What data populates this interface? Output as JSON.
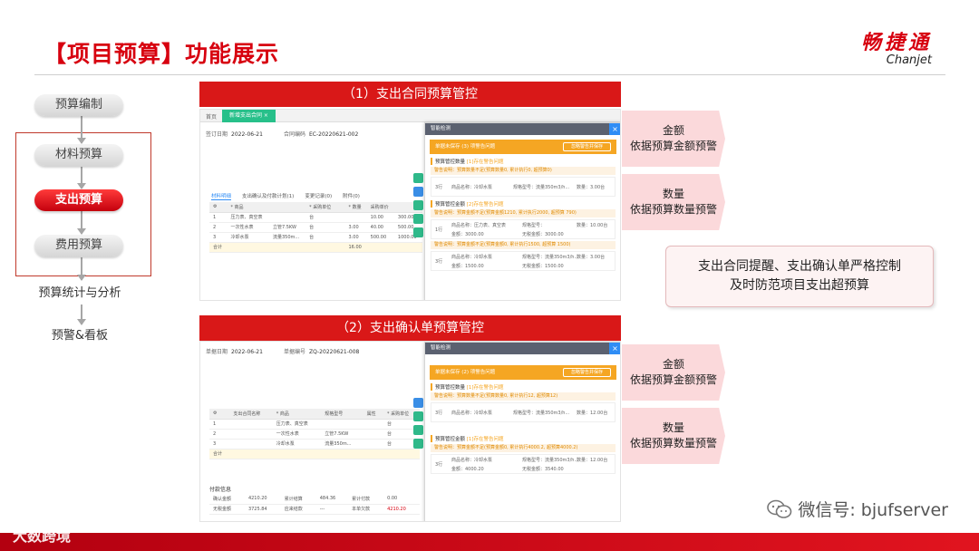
{
  "header": {
    "title": "【项目预算】功能展示",
    "logo_cn": "畅捷通",
    "logo_en": "Chanjet"
  },
  "flow": {
    "step1": "预算编制",
    "step2": "材料预算",
    "step3": "支出预算",
    "step4": "费用预算",
    "step5": "预算统计与分析",
    "step6": "预警&看板"
  },
  "panel1": {
    "banner": "（1）支出合同预算管控",
    "tab_home": "首页",
    "tab_active": "新增支出合同 ×",
    "date_label": "签订日期",
    "date_value": "2022-06-21",
    "code_label": "合同编码",
    "code_value": "EC-20220621-002",
    "subtabs": [
      "材料明细",
      "支出确认及付款计划(1)",
      "变更记录(0)",
      "附件(0)"
    ],
    "columns": [
      "⚙",
      "* 商品",
      "",
      "* 采购单位",
      "",
      "* 数量",
      "采购单价",
      ""
    ],
    "rows": [
      [
        "1",
        "压力表、真空表",
        "",
        "台",
        "",
        "",
        "10.00",
        "300.00"
      ],
      [
        "2",
        "一次性水表",
        "立管7.5KW",
        "台",
        "",
        "3.00",
        "40.00",
        "500.00"
      ],
      [
        "3",
        "冷却水泵",
        "流量350m...",
        "台",
        "",
        "3.00",
        "500.00",
        "1000.00"
      ]
    ],
    "total_label": "合计",
    "total_value": "16.00",
    "dialog": {
      "title": "智能检测",
      "alert": "单据未保存 (3) 项警告问题",
      "alert_button": "忽略警告并保存",
      "sec1": "预算管控数量",
      "sec1_tag": "[1]存在警告问题",
      "warn1": "警告说明：预算数量不足(预算数量0, 累计执行0, 超预算0)",
      "item1": {
        "idx": "3行",
        "name": "商品名称：冷却水泵",
        "spec": "规格型号：流量350m3/h...",
        "qty": "数量：3.00台"
      },
      "sec2": "预算管控金额",
      "sec2_tag": "[2]存在警告问题",
      "warn2": "警告说明：预算金额不足(预算金额1210, 累计执行2000, 超预算 790)",
      "item2": {
        "idx": "1行",
        "name": "商品名称：压力表、真空表",
        "spec": "规格型号：",
        "qty": "数量：10.00台",
        "amount": "金额：3000.00",
        "tax": "无税金额：3000.00"
      },
      "warn3": "警告说明：预算金额不足(预算金额0, 累计执行1500, 超预算 1500)",
      "item3": {
        "idx": "3行",
        "name": "商品名称：冷却水泵",
        "spec": "规格型号：流量350m3/h...",
        "qty": "数量：3.00台",
        "amount": "金额：1500.00",
        "tax": "无税金额：1500.00"
      }
    }
  },
  "panel2": {
    "banner": "（2）支出确认单预算管控",
    "date_label": "单据日期",
    "date_value": "2022-06-21",
    "code_label": "单据编号",
    "code_value": "ZQ-20220621-008",
    "columns": [
      "⚙",
      "支出合同名称",
      "* 商品",
      "规格型号",
      "属性",
      "* 采购单位"
    ],
    "rows": [
      [
        "1",
        "",
        "压力表、真空表",
        "",
        "",
        "台"
      ],
      [
        "2",
        "",
        "一次性水表",
        "立管7.5KW",
        "",
        "台"
      ],
      [
        "3",
        "",
        "冷却水泵",
        "流量350m...",
        "",
        "台"
      ]
    ],
    "total_label": "合计",
    "pay_title": "付款信息",
    "pay_rows": [
      [
        "确认金额",
        "4210.20",
        "累计结算",
        "484.36",
        "累计付款",
        "0.00"
      ],
      [
        "无税金额",
        "3725.84",
        "应来结款",
        "---",
        "本单欠款",
        "4210.20"
      ]
    ],
    "dialog": {
      "title": "智能检测",
      "alert": "单据未保存 (2) 项警告问题",
      "alert_button": "忽略警告并保存",
      "sec1": "预算管控数量",
      "sec1_tag": "[1]存在警告问题",
      "warn1": "警告说明：预算数量不足(预算数量0, 累计执行12, 超预算12)",
      "item1": {
        "idx": "3行",
        "name": "商品名称：冷却水泵",
        "spec": "规格型号：流量350m3/h...",
        "qty": "数量：12.00台"
      },
      "sec2": "预算管控金额",
      "sec2_tag": "[1]存在警告问题",
      "warn2": "警告说明：预算金额不足(预算金额0, 累计执行4000.2, 超预算4000.2)",
      "item2": {
        "idx": "3行",
        "name": "商品名称：冷却水泵",
        "spec": "规格型号：流量350m3/h...",
        "qty": "数量：12.00台",
        "amount": "金额：4000.20",
        "tax": "无税金额：3540.00"
      }
    }
  },
  "callouts": {
    "c1_line1": "金额",
    "c1_line2": "依据预算金额预警",
    "c2_line1": "数量",
    "c2_line2": "依据预算数量预警",
    "c3_line1": "金额",
    "c3_line2": "依据预算金额预警",
    "c4_line1": "数量",
    "c4_line2": "依据预算数量预警"
  },
  "note": {
    "line1": "支出合同提醒、支出确认单严格控制",
    "line2": "及时防范项目支出超预算"
  },
  "footer": {
    "wechat": "微信号: bjufserver",
    "watermark": "大数跨境"
  },
  "colors": {
    "brand_red": "#d7000f",
    "banner_red": "#d91818",
    "warning_orange": "#f5a623",
    "tab_green": "#27c08a",
    "link_blue": "#2f8df5"
  }
}
